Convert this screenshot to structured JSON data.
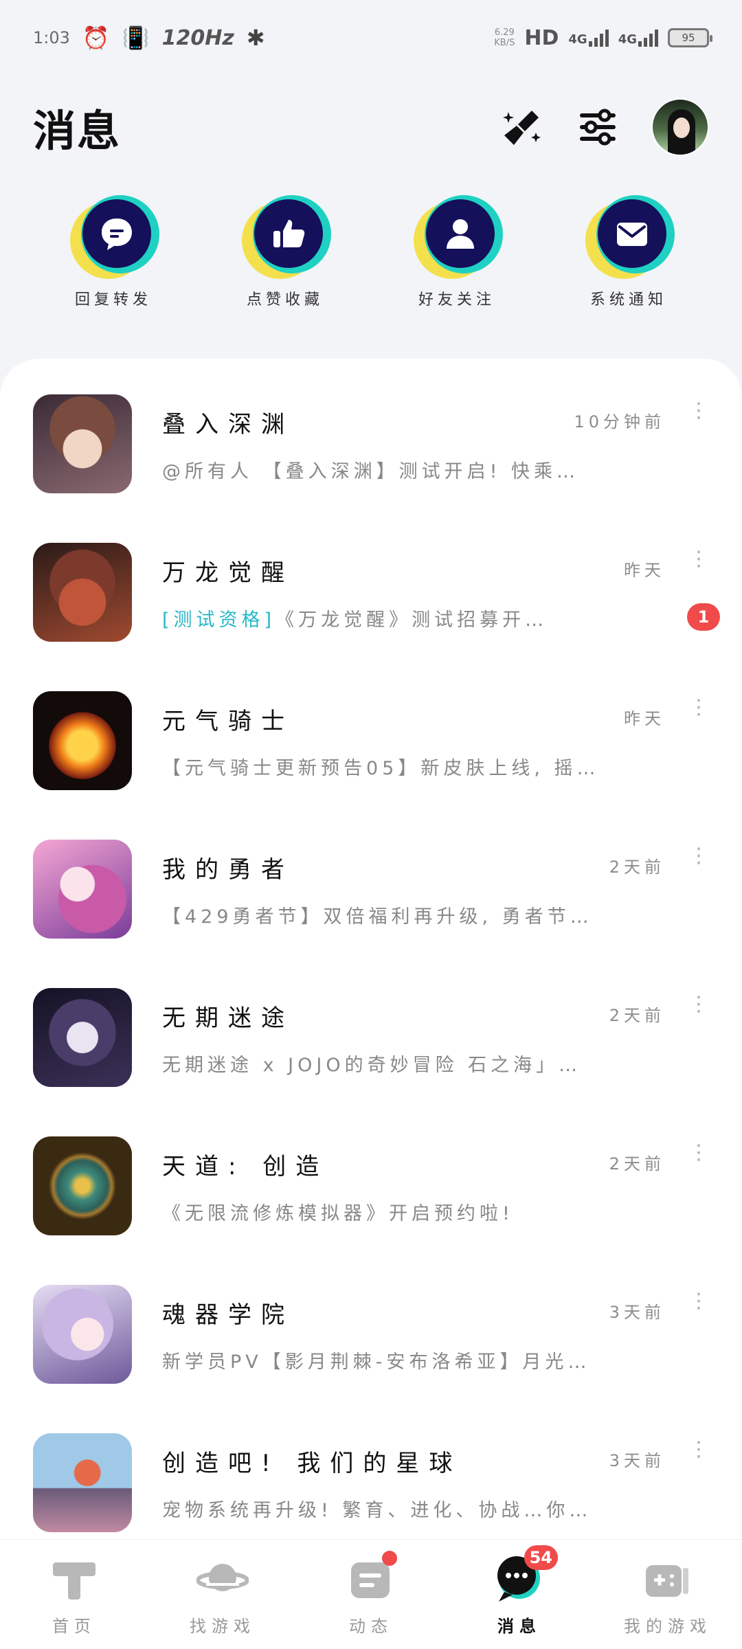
{
  "status_bar": {
    "time": "1:03",
    "refresh_rate": "120Hz",
    "net_speed_value": "6.29",
    "net_speed_unit": "KB/S",
    "hd_label": "HD",
    "signal_1": "4G",
    "signal_2": "4G",
    "battery": "95"
  },
  "header": {
    "title": "消息"
  },
  "quick_actions": [
    {
      "label": "回复转发",
      "icon": "reply-icon"
    },
    {
      "label": "点赞收藏",
      "icon": "thumbs-up-icon"
    },
    {
      "label": "好友关注",
      "icon": "person-icon"
    },
    {
      "label": "系统通知",
      "icon": "mail-icon"
    }
  ],
  "messages": [
    {
      "title": "叠入深渊",
      "time": "10分钟前",
      "preview": "@所有人 【叠入深渊】测试开启! 快乘…",
      "tag": "",
      "unread": ""
    },
    {
      "title": "万龙觉醒",
      "time": "昨天",
      "preview": "《万龙觉醒》测试招募开…",
      "tag": "[测试资格]",
      "unread": "1"
    },
    {
      "title": "元气骑士",
      "time": "昨天",
      "preview": "【元气骑士更新预告05】新皮肤上线, 摇…",
      "tag": "",
      "unread": ""
    },
    {
      "title": "我的勇者",
      "time": "2天前",
      "preview": "【429勇者节】双倍福利再升级, 勇者节…",
      "tag": "",
      "unread": ""
    },
    {
      "title": "无期迷途",
      "time": "2天前",
      "preview": "无期迷途 x JOJO的奇妙冒险 石之海」…",
      "tag": "",
      "unread": ""
    },
    {
      "title": "天道: 创造",
      "time": "2天前",
      "preview": "《无限流修炼模拟器》开启预约啦!",
      "tag": "",
      "unread": ""
    },
    {
      "title": "魂器学院",
      "time": "3天前",
      "preview": "新学员PV【影月荆棘-安布洛希亚】月光…",
      "tag": "",
      "unread": ""
    },
    {
      "title": "创造吧! 我们的星球",
      "time": "3天前",
      "preview": "宠物系统再升级! 繁育、进化、协战…你…",
      "tag": "",
      "unread": ""
    }
  ],
  "bottom_nav": [
    {
      "label": "首页"
    },
    {
      "label": "找游戏"
    },
    {
      "label": "动态"
    },
    {
      "label": "消息",
      "badge": "54"
    },
    {
      "label": "我的游戏"
    }
  ],
  "colors": {
    "accent_teal": "#24b8c7",
    "badge_red": "#f04a4a",
    "icon_navy": "#15105a",
    "icon_cyan": "#1fd1c3",
    "icon_yellow": "#f4e04c"
  }
}
